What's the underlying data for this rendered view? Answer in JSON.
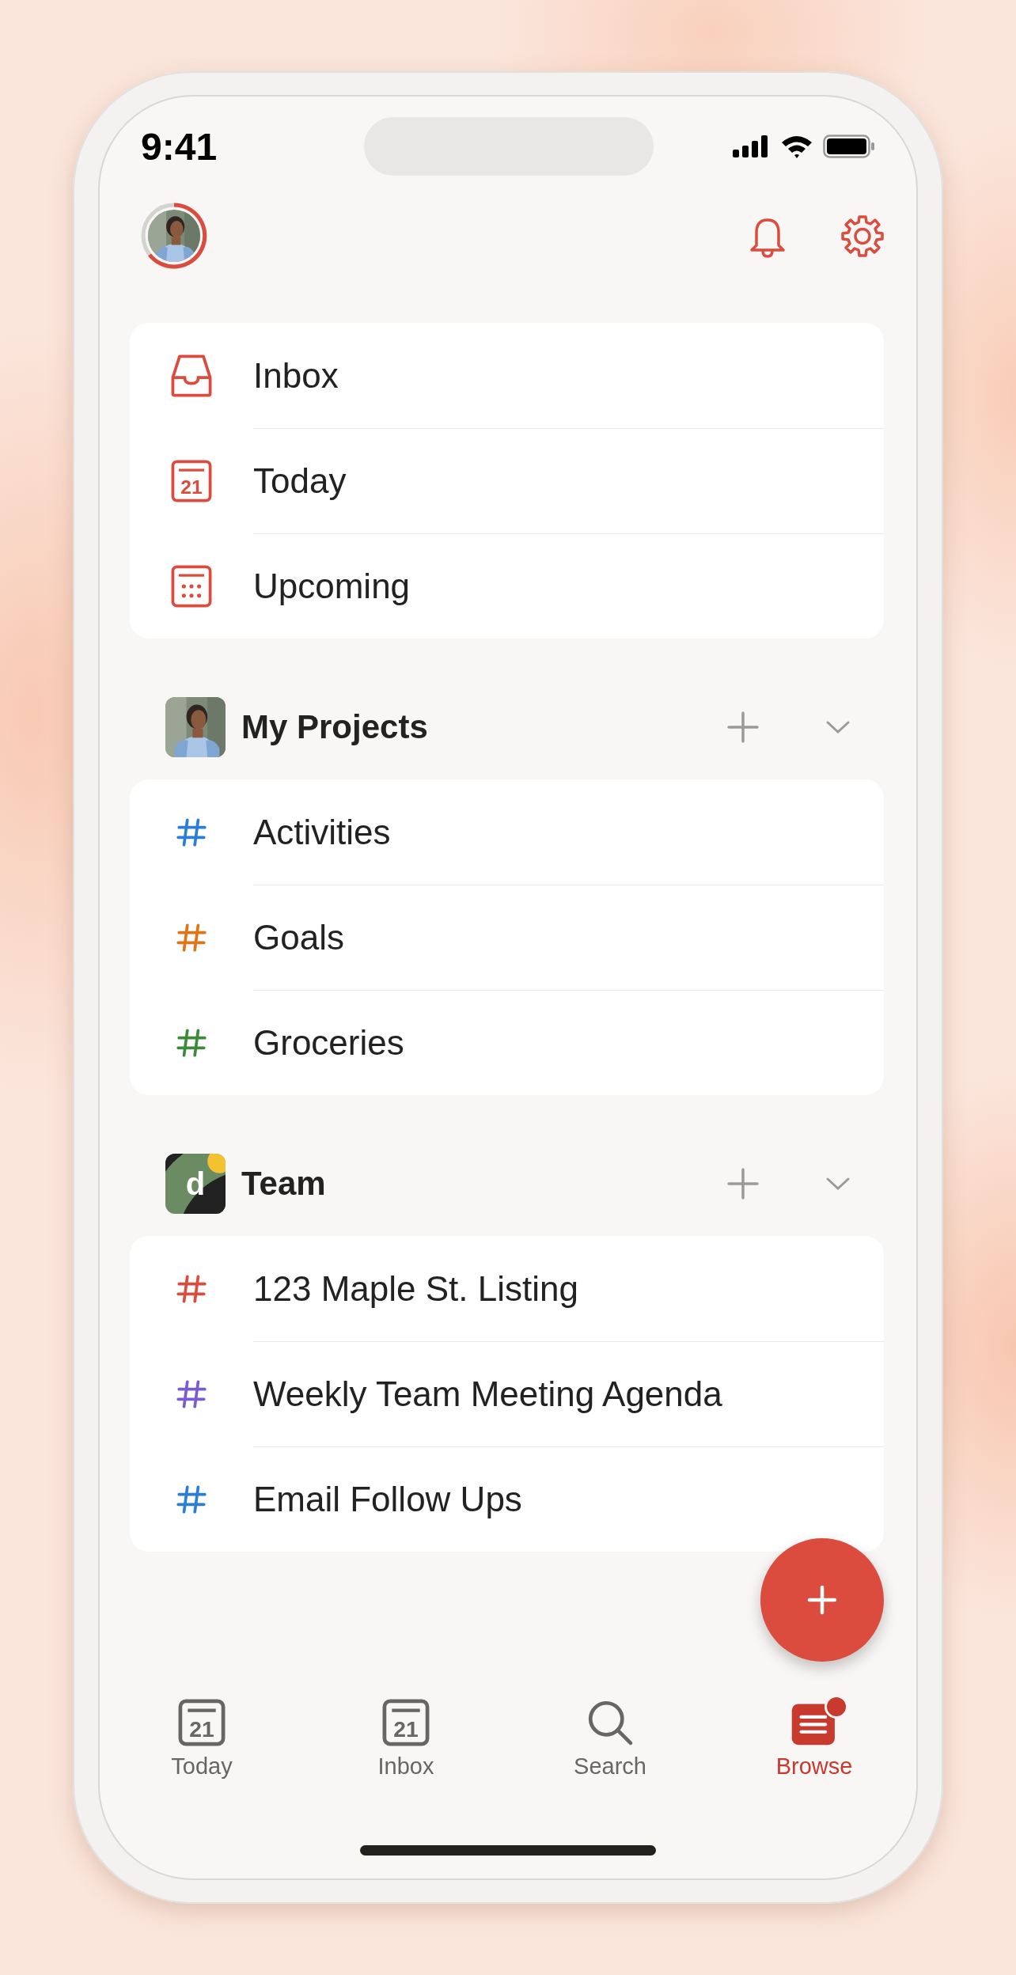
{
  "status_bar": {
    "time": "9:41"
  },
  "views": [
    {
      "kind": "inbox",
      "label": "Inbox"
    },
    {
      "kind": "calendar",
      "label": "Today",
      "date": "21"
    },
    {
      "kind": "upcoming",
      "label": "Upcoming"
    }
  ],
  "groups": [
    {
      "kind": "personal",
      "title": "My Projects",
      "expanded": true,
      "projects": [
        {
          "name": "Activities",
          "color": "#2a7fd4"
        },
        {
          "name": "Goals",
          "color": "#e07516"
        },
        {
          "name": "Groceries",
          "color": "#3d8a3a"
        }
      ]
    },
    {
      "kind": "team",
      "title": "Team",
      "logo_letter": "d",
      "expanded": true,
      "projects": [
        {
          "name": "123 Maple St. Listing",
          "color": "#dc4c3e"
        },
        {
          "name": "Weekly Team Meeting Agenda",
          "color": "#7a5bd1"
        },
        {
          "name": "Email Follow Ups",
          "color": "#2a7fd4"
        }
      ]
    }
  ],
  "tabs": [
    {
      "kind": "calendar",
      "label": "Today",
      "date": "21",
      "selected": false
    },
    {
      "kind": "calendar",
      "label": "Inbox",
      "date": "21",
      "selected": false
    },
    {
      "kind": "search",
      "label": "Search",
      "selected": false
    },
    {
      "kind": "browse",
      "label": "Browse",
      "selected": true,
      "badge": true
    }
  ]
}
